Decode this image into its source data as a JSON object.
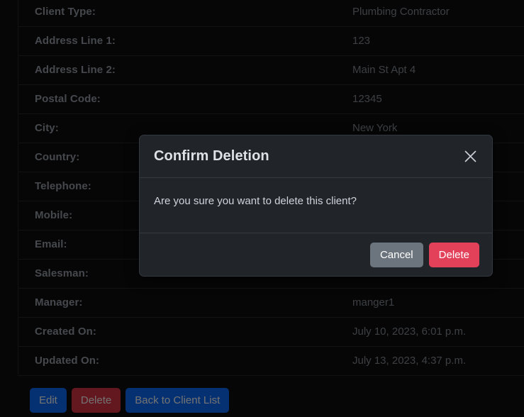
{
  "detail": {
    "rows": [
      {
        "label": "Client Type:",
        "value": "Plumbing Contractor"
      },
      {
        "label": "Address Line 1:",
        "value": "123"
      },
      {
        "label": "Address Line 2:",
        "value": "Main St Apt 4"
      },
      {
        "label": "Postal Code:",
        "value": "12345"
      },
      {
        "label": "City:",
        "value": "New York"
      },
      {
        "label": "Country:",
        "value": ""
      },
      {
        "label": "Telephone:",
        "value": ""
      },
      {
        "label": "Mobile:",
        "value": ""
      },
      {
        "label": "Email:",
        "value": ""
      },
      {
        "label": "Salesman:",
        "value": ""
      },
      {
        "label": "Manager:",
        "value": "manger1"
      },
      {
        "label": "Created On:",
        "value": "July 10, 2023, 6:01 p.m."
      },
      {
        "label": "Updated On:",
        "value": "July 13, 2023, 4:37 p.m."
      }
    ]
  },
  "actions": {
    "edit_label": "Edit",
    "delete_label": "Delete",
    "back_label": "Back to Client List"
  },
  "modal": {
    "title": "Confirm Deletion",
    "close_icon": "close-icon",
    "message": "Are you sure you want to delete this client?",
    "cancel_label": "Cancel",
    "confirm_label": "Delete"
  },
  "colors": {
    "page_background": "#0e0f11",
    "modal_background": "#212529",
    "primary": "#0d6efd",
    "danger": "#dc3545",
    "secondary": "#6c757d",
    "confirm_delete": "#e3405a",
    "divider": "#26292d",
    "label_text": "#9aa1a8",
    "value_text": "#868e96"
  }
}
